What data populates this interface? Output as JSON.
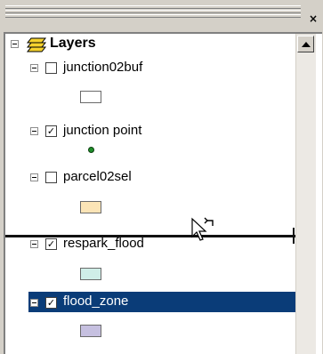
{
  "window": {
    "close_glyph": "×"
  },
  "tree": {
    "root": {
      "label": "Layers",
      "icon": "layers-icon",
      "expander": "minus"
    },
    "layers": [
      {
        "name": "junction02buf",
        "checked": false,
        "symbol": "polygon",
        "symbol_color": "#ffffff"
      },
      {
        "name": "junction point",
        "checked": true,
        "symbol": "point",
        "symbol_color": "#1f8f2a"
      },
      {
        "name": "parcel02sel",
        "checked": false,
        "symbol": "polygon",
        "symbol_color": "#fbe4b6"
      },
      {
        "name": "respark_flood",
        "checked": true,
        "symbol": "polygon",
        "symbol_color": "#cfeee8"
      },
      {
        "name": "flood_zone",
        "checked": true,
        "symbol": "polygon",
        "symbol_color": "#c6c0e0",
        "selected": true
      }
    ],
    "check_glyph": "✓"
  },
  "colors": {
    "selection": "#0a3c78",
    "panel_bg": "#d4d0c8"
  }
}
